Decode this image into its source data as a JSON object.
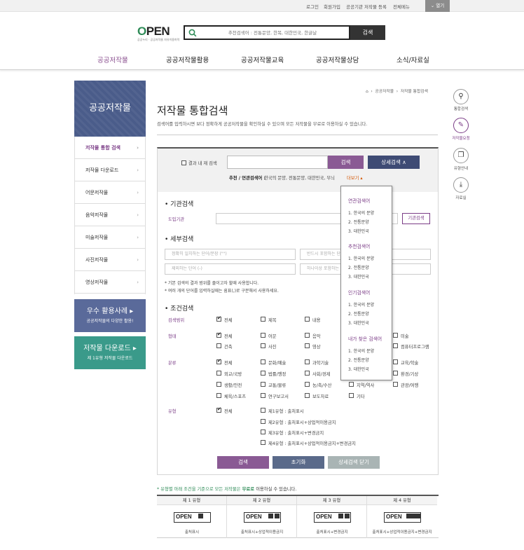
{
  "utility": {
    "login": "로그인",
    "join": "회원가입",
    "register": "공공기관 저작물 등록",
    "sitemap": "전체메뉴",
    "open": "열기"
  },
  "logo": {
    "text_o": "O",
    "text_pen": "PEN",
    "sub": "공공누리 · 공공저작물 자유이용허락"
  },
  "top_search": {
    "placeholder": "추천검색어 : 전통문양, 한복, 대한민국, 한글날",
    "button": "검색"
  },
  "gnb": [
    "공공저작물",
    "공공저작물활용",
    "공공저작물교육",
    "공공저작물상담",
    "소식/자료실"
  ],
  "sidebar": {
    "title": "공공저작물",
    "items": [
      "저작물 통합 검색",
      "저작물 다운로드",
      "어문저작물",
      "음악저작물",
      "미술저작물",
      "사진저작물",
      "영상저작물"
    ]
  },
  "banners": [
    {
      "title": "우수 활용사례 ▸",
      "sub": "공공저작물의 다양한 활용!",
      "color": "#5a6a9a"
    },
    {
      "title": "저작물 다운로드 ▸",
      "sub": "제 1유형 저작물 다운로드",
      "color": "#3a9a8a"
    }
  ],
  "breadcrumb": [
    "⌂",
    "›",
    "공공저작물",
    "›",
    "저작물 통합검색"
  ],
  "page": {
    "title": "저작물 통합검색",
    "desc": "검색어를 입력하시면 보다 정확하게 공공저작물을 확인하실 수 있으며 모든 저작물을 무료로 이용하실 수 있습니다."
  },
  "search": {
    "within_label": "결과 내 재 검색",
    "button": "검색",
    "detail_button": "상세검색  ∧",
    "rec_label": "추천 / 연관검색어 :",
    "rec_words": "한국의 문양, 전통문양, 대한민국, 무늬",
    "more": "더보기 ▴"
  },
  "dropdown": {
    "sections": [
      {
        "title": "연관검색어",
        "items": [
          "1. 한국의 문양",
          "2. 전통문양",
          "3. 대한민국"
        ]
      },
      {
        "title": "추천검색어",
        "items": [
          "1. 한국의 문양",
          "2. 전통문양",
          "3. 대한민국"
        ]
      },
      {
        "title": "인기검색어",
        "items": [
          "1. 한국의 문양",
          "2. 전통문양",
          "3. 대한민국"
        ]
      },
      {
        "title": "내가 찾은 검색어",
        "items": [
          "1. 한국의 문양",
          "2. 전통문양",
          "3. 대한민국"
        ]
      }
    ]
  },
  "agency": {
    "section": "기관검색",
    "label": "도입기관",
    "button": "기관검색"
  },
  "detail": {
    "section": "세부검색",
    "placeholders": [
      "정확히 일치하는 단어/문장 (\"\")",
      "반드시 포함하는 단어",
      "제외하는 단어 (-)",
      "하나이상 포함하는 단어"
    ],
    "notes": [
      "* 기본 검색의 결과 범위를 줄이고자 할때 사용합니다.",
      "* 여러 개의 단어를 입력하실때는 쉼표(,)로 구분해서 사용하세요."
    ]
  },
  "conditions": {
    "section": "조건검색",
    "scope": {
      "label": "검색범위",
      "opts": [
        "전체",
        "제목",
        "내용"
      ]
    },
    "form": {
      "label": "형태",
      "opts": [
        "전체",
        "어문",
        "음악",
        "미술",
        "건축",
        "사진",
        "영상",
        "컴퓨터프로그램"
      ]
    },
    "category": {
      "label": "분류",
      "opts": [
        "전체",
        "문화/예술",
        "과학기술",
        "교육/학술",
        "외교/국방",
        "법률/행정",
        "사회/경제",
        "환경/기상",
        "생활/안전",
        "교통/물류",
        "농/축/수산",
        "지역/역사",
        "관광/여행",
        "체육/스포츠",
        "연구보고서",
        "보도자료",
        "기타"
      ]
    },
    "type": {
      "label": "유형",
      "opts": [
        "전체",
        "제1유형 : 출처표시",
        "제2유형 : 출처표시+상업적이용금지",
        "제3유형 : 출처표시+변경금지",
        "제4유형 : 출처표시+상업적이용금지+변경금지"
      ]
    }
  },
  "actions": {
    "search": "검색",
    "reset": "초기화",
    "close": "상세검색 닫기"
  },
  "quick": [
    {
      "label": "통합검색",
      "icon": "⚲"
    },
    {
      "label": "저작물요청",
      "icon": "✎"
    },
    {
      "label": "유형안내",
      "icon": "❐"
    },
    {
      "label": "자료실",
      "icon": "⤓"
    }
  ],
  "bottom_note": {
    "prefix": "* 유형별 아래 조건을 기준으로 모든 저작물은",
    "highlight": " 무료로 ",
    "suffix": "이용하실 수 있습니다."
  },
  "license": {
    "headers": [
      "제 1 유형",
      "제 2 유형",
      "제 3 유형",
      "제 4 유형"
    ],
    "captions": [
      "출처표시",
      "출처표시+상업적이용금지",
      "출처표시+변경금지",
      "출처표시+상업적이용금지+변경금지"
    ],
    "mark": "OPEN"
  },
  "colors": {
    "accent": "#7b3d87",
    "dark": "#333333",
    "navy": "#4a5c8a",
    "teal": "#3a9a8a"
  }
}
